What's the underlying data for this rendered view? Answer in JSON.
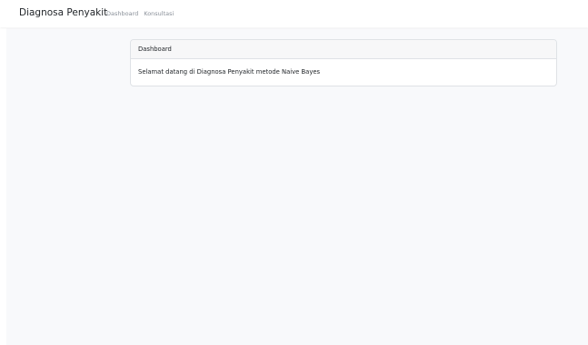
{
  "navbar": {
    "brand": "Diagnosa Penyakit",
    "links": [
      {
        "label": "Dashboard"
      },
      {
        "label": "Konsultasi"
      }
    ]
  },
  "card": {
    "header": "Dashboard",
    "body": "Selamat datang di Diagnosa Penyakit metode Naive Bayes"
  },
  "colors": {
    "page_background": "#f8f9fb",
    "navbar_background": "#ffffff",
    "card_border": "#dfe2e6",
    "nav_link_text": "#8a9099"
  }
}
